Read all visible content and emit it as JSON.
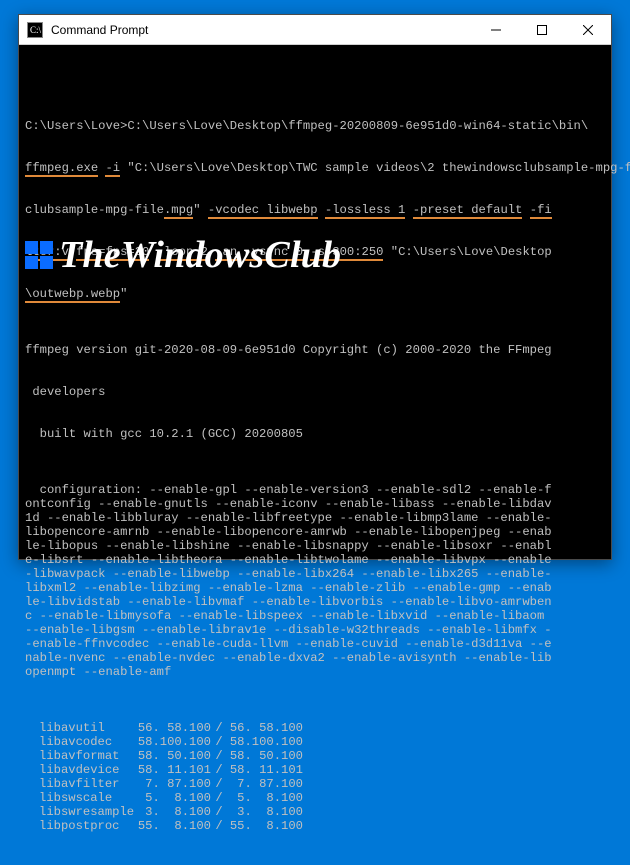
{
  "window": {
    "title": "Command Prompt"
  },
  "cmd": {
    "prompt": "C:\\Users\\Love>",
    "path_prefix": "C:\\Users\\Love\\Desktop\\ffmpeg-20200809-6e951d0-win64-static\\bin\\",
    "exe": "ffmpeg.exe",
    "flag_i": "-i",
    "arg_input_a": " \"C:\\Users\\Love\\Desktop\\TWC sample videos\\2 thewindowsclubsample-mpg-file",
    "arg_input_b": ".mpg",
    "arg_input_c": "\" ",
    "vcodec": "-vcodec libwebp",
    "sp1": " ",
    "lossless": "-lossless 1",
    "sp2": " ",
    "preset": "-preset default",
    "sp3": " ",
    "filter_a": "-fi",
    "filter_b": "lter:v",
    "sp4": " ",
    "fps": "fps=fps=30",
    "sp5": " ",
    "loop": "-loop 2",
    "sp6": " ",
    "an": "-an",
    "sp7": " ",
    "vsync": "-vsync 0",
    "sp8": " ",
    "size": "-s 300:250",
    "out_a": " \"C:\\Users\\Love\\Desktop",
    "out_b": "\\outwebp.webp",
    "out_c": "\""
  },
  "banner": {
    "line1": "ffmpeg version git-2020-08-09-6e951d0 Copyright (c) 2000-2020 the FFmpeg",
    "line2": " developers",
    "built": "  built with gcc 10.2.1 (GCC) 20200805"
  },
  "config": [
    "  configuration: --enable-gpl --enable-version3 --enable-sdl2 --enable-f",
    "ontconfig --enable-gnutls --enable-iconv --enable-libass --enable-libdav",
    "1d --enable-libbluray --enable-libfreetype --enable-libmp3lame --enable-",
    "libopencore-amrnb --enable-libopencore-amrwb --enable-libopenjpeg --enab",
    "le-libopus --enable-libshine --enable-libsnappy --enable-libsoxr --enabl",
    "e-libsrt --enable-libtheora --enable-libtwolame --enable-libvpx --enable",
    "-libwavpack --enable-libwebp --enable-libx264 --enable-libx265 --enable-",
    "libxml2 --enable-libzimg --enable-lzma --enable-zlib --enable-gmp --enab",
    "le-libvidstab --enable-libvmaf --enable-libvorbis --enable-libvo-amrwben",
    "c --enable-libmysofa --enable-libspeex --enable-libxvid --enable-libaom ",
    "--enable-libgsm --enable-librav1e --disable-w32threads --enable-libmfx -",
    "-enable-ffnvcodec --enable-cuda-llvm --enable-cuvid --enable-d3d11va --e",
    "nable-nvenc --enable-nvdec --enable-dxva2 --enable-avisynth --enable-lib",
    "openmpt --enable-amf"
  ],
  "libs": [
    {
      "name": "libavutil",
      "v1": "56. 58.100",
      "v2": "56. 58.100"
    },
    {
      "name": "libavcodec",
      "v1": "58.100.100",
      "v2": "58.100.100"
    },
    {
      "name": "libavformat",
      "v1": "58. 50.100",
      "v2": "58. 50.100"
    },
    {
      "name": "libavdevice",
      "v1": "58. 11.101",
      "v2": "58. 11.101"
    },
    {
      "name": "libavfilter",
      "v1": " 7. 87.100",
      "v2": " 7. 87.100"
    },
    {
      "name": "libswscale",
      "v1": " 5.  8.100",
      "v2": " 5.  8.100"
    },
    {
      "name": "libswresample",
      "v1": " 3.  8.100",
      "v2": " 3.  8.100"
    },
    {
      "name": "libpostproc",
      "v1": "55.  8.100",
      "v2": "55.  8.100"
    }
  ],
  "watermark": "TheWindowsClub"
}
